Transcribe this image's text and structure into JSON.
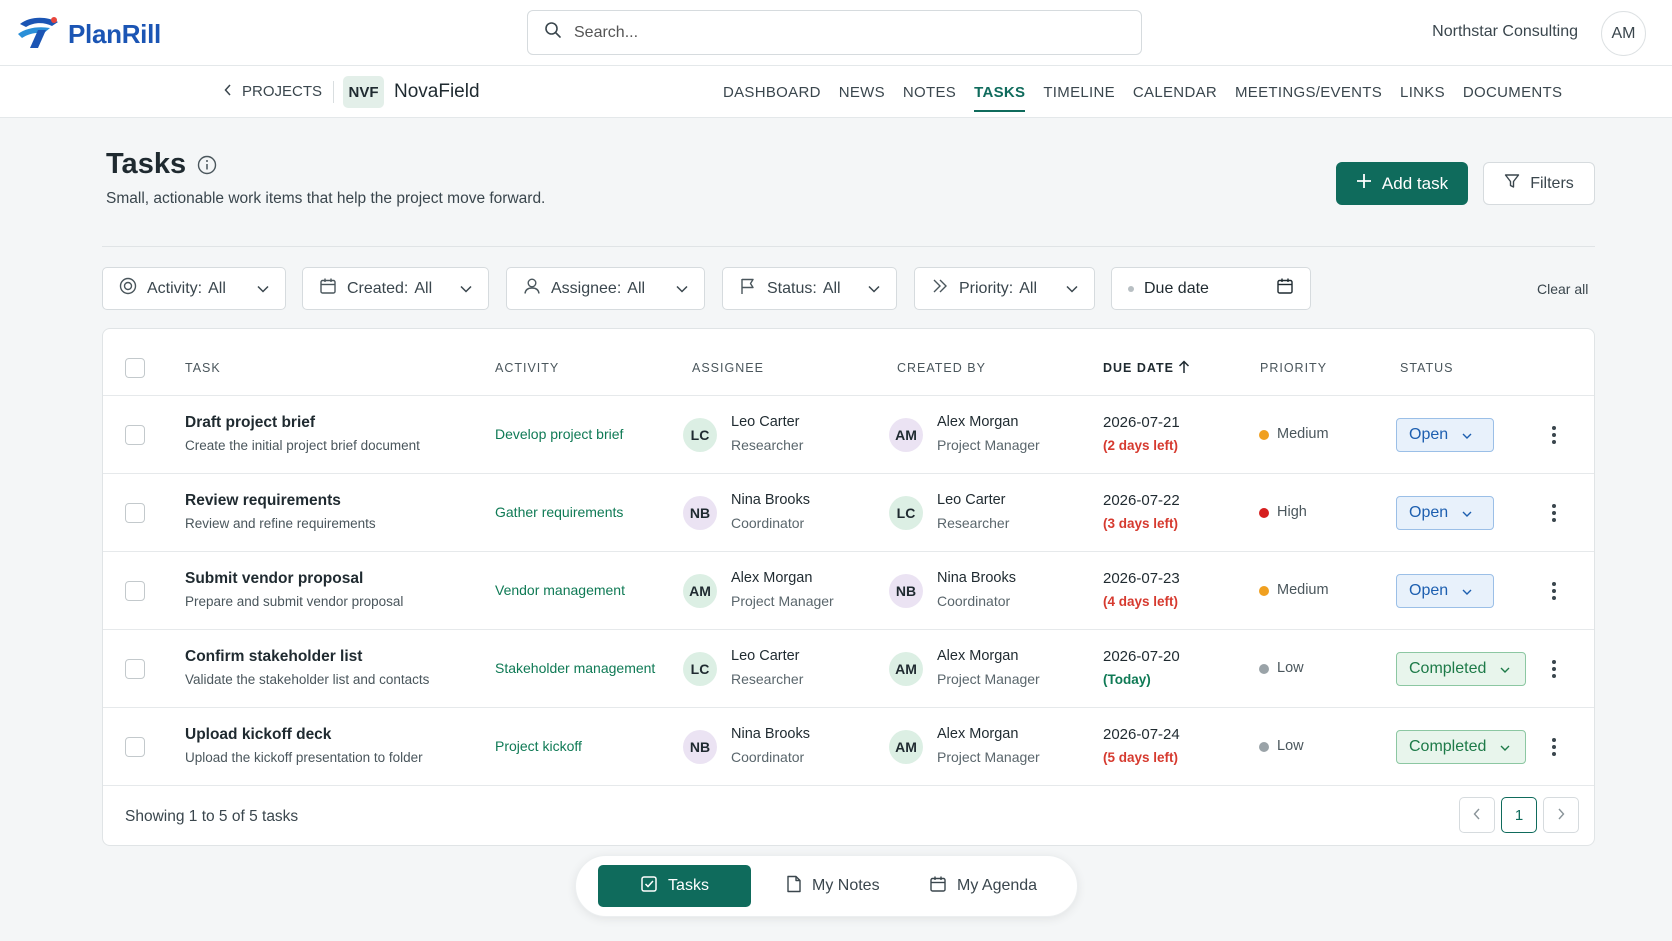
{
  "app": {
    "name": "PlanRill",
    "org": "Northstar Consulting",
    "user_initials": "AM"
  },
  "search": {
    "placeholder": "Search..."
  },
  "subnav": {
    "back_label": "PROJECTS",
    "project_code": "NVF",
    "project_name": "NovaField",
    "tabs": [
      "DASHBOARD",
      "NEWS",
      "NOTES",
      "TASKS",
      "TIMELINE",
      "CALENDAR",
      "MEETINGS/EVENTS",
      "LINKS",
      "DOCUMENTS"
    ],
    "active_tab": "TASKS"
  },
  "page": {
    "title": "Tasks",
    "subtitle": "Small, actionable work items that help the project move forward.",
    "add_label": "Add task",
    "filters_label": "Filters"
  },
  "filters": {
    "activity": {
      "label": "Activity:",
      "value": "All"
    },
    "created": {
      "label": "Created:",
      "value": "All"
    },
    "assignee": {
      "label": "Assignee:",
      "value": "All"
    },
    "status": {
      "label": "Status:",
      "value": "All"
    },
    "priority": {
      "label": "Priority:",
      "value": "All"
    },
    "due_date": {
      "label": "Due date"
    },
    "clear_all": "Clear all"
  },
  "table": {
    "headers": {
      "task": "TASK",
      "activity": "ACTIVITY",
      "assignee": "ASSIGNEE",
      "created_by": "CREATED BY",
      "due_date": "DUE DATE",
      "priority": "PRIORITY",
      "status": "STATUS"
    },
    "rows": [
      {
        "title": "Draft project brief",
        "desc": "Create the initial project brief document",
        "activity": "Develop project brief",
        "assignee": {
          "initials": "LC",
          "name": "Leo Carter",
          "role": "Researcher"
        },
        "creator": {
          "initials": "AM",
          "name": "Alex Morgan",
          "role": "Project Manager"
        },
        "due": "2026-07-21",
        "due_note": "(2 days left)",
        "priority": "Medium",
        "status": "Open"
      },
      {
        "title": "Review requirements",
        "desc": "Review and refine requirements",
        "activity": "Gather requirements",
        "assignee": {
          "initials": "NB",
          "name": "Nina Brooks",
          "role": "Coordinator"
        },
        "creator": {
          "initials": "LC",
          "name": "Leo Carter",
          "role": "Researcher"
        },
        "due": "2026-07-22",
        "due_note": "(3 days left)",
        "priority": "High",
        "status": "Open"
      },
      {
        "title": "Submit vendor proposal",
        "desc": "Prepare and submit vendor proposal",
        "activity": "Vendor management",
        "assignee": {
          "initials": "AM",
          "name": "Alex Morgan",
          "role": "Project Manager"
        },
        "creator": {
          "initials": "NB",
          "name": "Nina Brooks",
          "role": "Coordinator"
        },
        "due": "2026-07-23",
        "due_note": "(4 days left)",
        "priority": "Medium",
        "status": "Open"
      },
      {
        "title": "Confirm stakeholder list",
        "desc": "Validate the stakeholder list and contacts",
        "activity": "Stakeholder management",
        "assignee": {
          "initials": "LC",
          "name": "Leo Carter",
          "role": "Researcher"
        },
        "creator": {
          "initials": "AM",
          "name": "Alex Morgan",
          "role": "Project Manager"
        },
        "due": "2026-07-20",
        "due_note": "(Today)",
        "priority": "Low",
        "status": "Completed"
      },
      {
        "title": "Upload kickoff deck",
        "desc": "Upload the kickoff presentation to folder",
        "activity": "Project kickoff",
        "assignee": {
          "initials": "NB",
          "name": "Nina Brooks",
          "role": "Coordinator"
        },
        "creator": {
          "initials": "AM",
          "name": "Alex Morgan",
          "role": "Project Manager"
        },
        "due": "2026-07-24",
        "due_note": "(5 days left)",
        "priority": "Low",
        "status": "Completed"
      }
    ],
    "footer": "Showing 1 to 5 of 5 tasks",
    "current_page": "1"
  },
  "bottom_nav": {
    "tasks": "Tasks",
    "notes": "My Notes",
    "agenda": "My Agenda"
  },
  "colors": {
    "accent": "#0f6b5c",
    "overdue": "#d63a2f",
    "today": "#0f7a55",
    "medium": "#f0a020",
    "high": "#d61f1f",
    "low": "#9aa3a8"
  }
}
